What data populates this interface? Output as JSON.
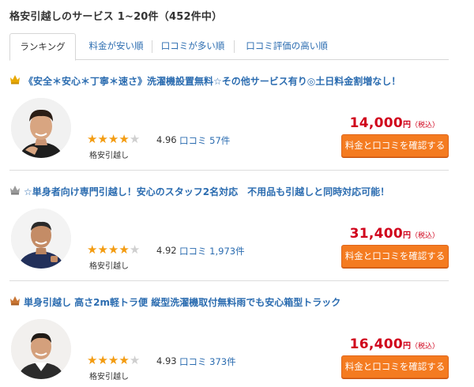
{
  "header": {
    "title": "格安引越しのサービス 1~20件（452件中）"
  },
  "tabs": [
    {
      "label": "ランキング",
      "active": true
    },
    {
      "label": "料金が安い順",
      "active": false
    },
    {
      "label": "口コミが多い順",
      "active": false
    },
    {
      "label": "口コミ評価の高い順",
      "active": false
    }
  ],
  "colors": {
    "link": "#2b6cb0",
    "price": "#d0021b",
    "cta": "#f47b20",
    "star": "#f39c12",
    "gold": "#e8a800",
    "silver": "#9a9a9a",
    "bronze": "#c87533"
  },
  "items": [
    {
      "rank": "1",
      "title": "《安全＊安心＊丁寧＊速さ》洗濯機設置無料☆その他サービス有り◎土日料金割増なし！",
      "rating": "4.96",
      "stars": 4,
      "review_label": "口コミ",
      "review_count": "57件",
      "category": "格安引越し",
      "price": "14,000",
      "yen": "円",
      "tax": "（税込）",
      "cta": "料金と口コミを確認する"
    },
    {
      "rank": "2",
      "title": "☆単身者向け専門引越し！安心のスタッフ2名対応　不用品も引越しと同時対応可能！",
      "rating": "4.92",
      "stars": 4,
      "review_label": "口コミ",
      "review_count": "1,973件",
      "category": "格安引越し",
      "price": "31,400",
      "yen": "円",
      "tax": "（税込）",
      "cta": "料金と口コミを確認する"
    },
    {
      "rank": "3",
      "title": "単身引越し 高さ2m軽トラ便 縦型洗濯機取付無料雨でも安心箱型トラック",
      "rating": "4.93",
      "stars": 4,
      "review_label": "口コミ",
      "review_count": "373件",
      "category": "格安引越し",
      "price": "16,400",
      "yen": "円",
      "tax": "（税込）",
      "cta": "料金と口コミを確認する"
    }
  ]
}
